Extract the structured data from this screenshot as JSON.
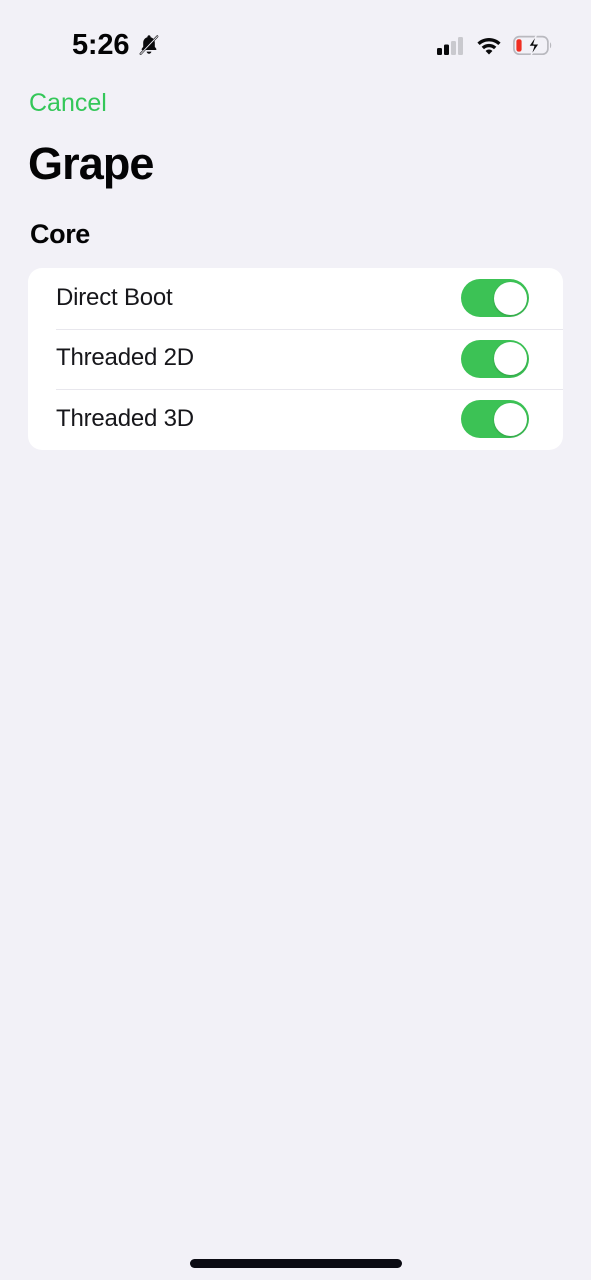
{
  "status_bar": {
    "time": "5:26",
    "silent_icon": "bell-slash-icon",
    "cellular_icon": "signal-bars-icon",
    "cellular_bars_filled": 2,
    "cellular_bars_total": 4,
    "wifi_icon": "wifi-icon",
    "battery_icon": "battery-charging-low-icon",
    "battery_level_color": "#f02e22",
    "battery_charging": true
  },
  "nav": {
    "cancel_label": "Cancel"
  },
  "header": {
    "title": "Grape"
  },
  "sections": [
    {
      "title": "Core",
      "rows": [
        {
          "label": "Direct Boot",
          "control": "toggle",
          "value": "on"
        },
        {
          "label": "Threaded 2D",
          "control": "toggle",
          "value": "on"
        },
        {
          "label": "Threaded 3D",
          "control": "toggle",
          "value": "on"
        }
      ]
    }
  ],
  "colors": {
    "background": "#f2f1f7",
    "card": "#ffffff",
    "accent_green": "#34c759",
    "toggle_on": "#3cc255",
    "separator": "#e8e7ed",
    "text_primary": "#040405"
  },
  "home_indicator": "home-indicator"
}
